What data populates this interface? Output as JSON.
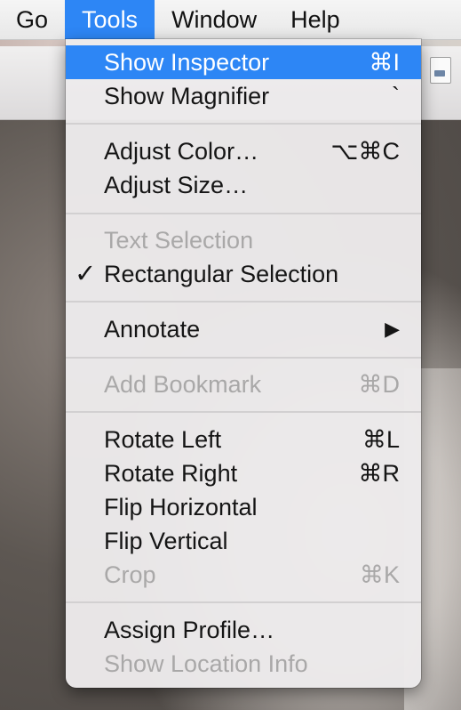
{
  "menubar": {
    "items": [
      "Go",
      "Tools",
      "Window",
      "Help"
    ]
  },
  "menu": {
    "show_inspector": {
      "label": "Show Inspector",
      "shortcut": "⌘I"
    },
    "show_magnifier": {
      "label": "Show Magnifier",
      "shortcut": "`"
    },
    "adjust_color": {
      "label": "Adjust Color…",
      "shortcut": "⌥⌘C"
    },
    "adjust_size": {
      "label": "Adjust Size…"
    },
    "text_selection": {
      "label": "Text Selection"
    },
    "rectangular_selection": {
      "label": "Rectangular Selection",
      "check": "✓"
    },
    "annotate": {
      "label": "Annotate",
      "arrow": "▶"
    },
    "add_bookmark": {
      "label": "Add Bookmark",
      "shortcut": "⌘D"
    },
    "rotate_left": {
      "label": "Rotate Left",
      "shortcut": "⌘L"
    },
    "rotate_right": {
      "label": "Rotate Right",
      "shortcut": "⌘R"
    },
    "flip_horizontal": {
      "label": "Flip Horizontal"
    },
    "flip_vertical": {
      "label": "Flip Vertical"
    },
    "crop": {
      "label": "Crop",
      "shortcut": "⌘K"
    },
    "assign_profile": {
      "label": "Assign Profile…"
    },
    "show_location_info": {
      "label": "Show Location Info"
    }
  },
  "icons": {
    "toolbar_document": "document-icon"
  },
  "colors": {
    "highlight": "#2d86f5",
    "disabled_text": "#a9a8a8"
  }
}
